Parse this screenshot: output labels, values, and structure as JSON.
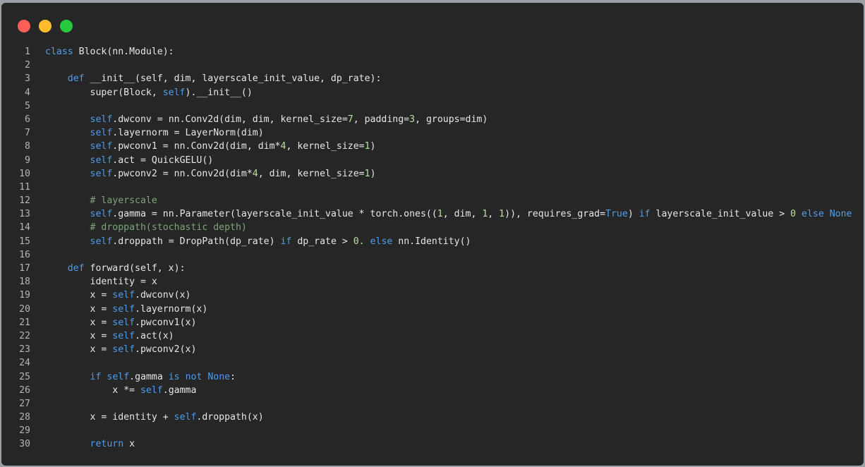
{
  "window": {
    "controls": [
      {
        "name": "close",
        "color": "#ff5f56"
      },
      {
        "name": "minimize",
        "color": "#ffbd2e"
      },
      {
        "name": "maximize",
        "color": "#27c93f"
      }
    ]
  },
  "colors": {
    "background": "#262626",
    "text": "#e6e6e6",
    "keyword": "#4f9cea",
    "comment": "#7fa47a",
    "number": "#b5e0a0",
    "line_number": "#b5b5b5"
  },
  "code": {
    "lines": [
      {
        "n": "1",
        "tokens": [
          [
            "kw",
            "class"
          ],
          [
            "t",
            " Block(nn.Module):"
          ]
        ]
      },
      {
        "n": "2",
        "tokens": []
      },
      {
        "n": "3",
        "tokens": [
          [
            "t",
            "    "
          ],
          [
            "kw",
            "def"
          ],
          [
            "t",
            " __init__(self, dim, layerscale_init_value, dp_rate):"
          ]
        ]
      },
      {
        "n": "4",
        "tokens": [
          [
            "t",
            "        super(Block, "
          ],
          [
            "kw",
            "self"
          ],
          [
            "t",
            ").__init__()"
          ]
        ]
      },
      {
        "n": "5",
        "tokens": []
      },
      {
        "n": "6",
        "tokens": [
          [
            "t",
            "        "
          ],
          [
            "kw",
            "self"
          ],
          [
            "t",
            ".dwconv = nn.Conv2d(dim, dim, kernel_size="
          ],
          [
            "nm",
            "7"
          ],
          [
            "t",
            ", padding="
          ],
          [
            "nm",
            "3"
          ],
          [
            "t",
            ", groups=dim)"
          ]
        ]
      },
      {
        "n": "7",
        "tokens": [
          [
            "t",
            "        "
          ],
          [
            "kw",
            "self"
          ],
          [
            "t",
            ".layernorm = LayerNorm(dim)"
          ]
        ]
      },
      {
        "n": "8",
        "tokens": [
          [
            "t",
            "        "
          ],
          [
            "kw",
            "self"
          ],
          [
            "t",
            ".pwconv1 = nn.Conv2d(dim, dim*"
          ],
          [
            "nm",
            "4"
          ],
          [
            "t",
            ", kernel_size="
          ],
          [
            "nm",
            "1"
          ],
          [
            "t",
            ")"
          ]
        ]
      },
      {
        "n": "9",
        "tokens": [
          [
            "t",
            "        "
          ],
          [
            "kw",
            "self"
          ],
          [
            "t",
            ".act = QuickGELU()"
          ]
        ]
      },
      {
        "n": "10",
        "tokens": [
          [
            "t",
            "        "
          ],
          [
            "kw",
            "self"
          ],
          [
            "t",
            ".pwconv2 = nn.Conv2d(dim*"
          ],
          [
            "nm",
            "4"
          ],
          [
            "t",
            ", dim, kernel_size="
          ],
          [
            "nm",
            "1"
          ],
          [
            "t",
            ")"
          ]
        ]
      },
      {
        "n": "11",
        "tokens": []
      },
      {
        "n": "12",
        "tokens": [
          [
            "t",
            "        "
          ],
          [
            "cm",
            "# layerscale"
          ]
        ]
      },
      {
        "n": "13",
        "tokens": [
          [
            "t",
            "        "
          ],
          [
            "kw",
            "self"
          ],
          [
            "t",
            ".gamma = nn.Parameter(layerscale_init_value * torch.ones(("
          ],
          [
            "nm",
            "1"
          ],
          [
            "t",
            ", dim, "
          ],
          [
            "nm",
            "1"
          ],
          [
            "t",
            ", "
          ],
          [
            "nm",
            "1"
          ],
          [
            "t",
            ")), requires_grad="
          ],
          [
            "kw",
            "True"
          ],
          [
            "t",
            ") "
          ],
          [
            "kw",
            "if"
          ],
          [
            "t",
            " layerscale_init_value > "
          ],
          [
            "nm",
            "0"
          ],
          [
            "t",
            " "
          ],
          [
            "kw",
            "else"
          ],
          [
            "t",
            " "
          ],
          [
            "kw",
            "None"
          ]
        ]
      },
      {
        "n": "14",
        "tokens": [
          [
            "t",
            "        "
          ],
          [
            "cm",
            "# droppath(stochastic depth)"
          ]
        ]
      },
      {
        "n": "15",
        "tokens": [
          [
            "t",
            "        "
          ],
          [
            "kw",
            "self"
          ],
          [
            "t",
            ".droppath = DropPath(dp_rate) "
          ],
          [
            "kw",
            "if"
          ],
          [
            "t",
            " dp_rate > "
          ],
          [
            "nm",
            "0."
          ],
          [
            "t",
            " "
          ],
          [
            "kw",
            "else"
          ],
          [
            "t",
            " nn.Identity()"
          ]
        ]
      },
      {
        "n": "16",
        "tokens": []
      },
      {
        "n": "17",
        "tokens": [
          [
            "t",
            "    "
          ],
          [
            "kw",
            "def"
          ],
          [
            "t",
            " forward(self, x):"
          ]
        ]
      },
      {
        "n": "18",
        "tokens": [
          [
            "t",
            "        identity = x"
          ]
        ]
      },
      {
        "n": "19",
        "tokens": [
          [
            "t",
            "        x = "
          ],
          [
            "kw",
            "self"
          ],
          [
            "t",
            ".dwconv(x)"
          ]
        ]
      },
      {
        "n": "20",
        "tokens": [
          [
            "t",
            "        x = "
          ],
          [
            "kw",
            "self"
          ],
          [
            "t",
            ".layernorm(x)"
          ]
        ]
      },
      {
        "n": "21",
        "tokens": [
          [
            "t",
            "        x = "
          ],
          [
            "kw",
            "self"
          ],
          [
            "t",
            ".pwconv1(x)"
          ]
        ]
      },
      {
        "n": "22",
        "tokens": [
          [
            "t",
            "        x = "
          ],
          [
            "kw",
            "self"
          ],
          [
            "t",
            ".act(x)"
          ]
        ]
      },
      {
        "n": "23",
        "tokens": [
          [
            "t",
            "        x = "
          ],
          [
            "kw",
            "self"
          ],
          [
            "t",
            ".pwconv2(x)"
          ]
        ]
      },
      {
        "n": "24",
        "tokens": []
      },
      {
        "n": "25",
        "tokens": [
          [
            "t",
            "        "
          ],
          [
            "kw",
            "if"
          ],
          [
            "t",
            " "
          ],
          [
            "kw",
            "self"
          ],
          [
            "t",
            ".gamma "
          ],
          [
            "kw",
            "is"
          ],
          [
            "t",
            " "
          ],
          [
            "kw",
            "not"
          ],
          [
            "t",
            " "
          ],
          [
            "kw",
            "None"
          ],
          [
            "t",
            ":"
          ]
        ]
      },
      {
        "n": "26",
        "tokens": [
          [
            "t",
            "            x *= "
          ],
          [
            "kw",
            "self"
          ],
          [
            "t",
            ".gamma"
          ]
        ]
      },
      {
        "n": "27",
        "tokens": []
      },
      {
        "n": "28",
        "tokens": [
          [
            "t",
            "        x = identity + "
          ],
          [
            "kw",
            "self"
          ],
          [
            "t",
            ".droppath(x)"
          ]
        ]
      },
      {
        "n": "29",
        "tokens": []
      },
      {
        "n": "30",
        "tokens": [
          [
            "t",
            "        "
          ],
          [
            "kw",
            "return"
          ],
          [
            "t",
            " x"
          ]
        ]
      }
    ]
  }
}
